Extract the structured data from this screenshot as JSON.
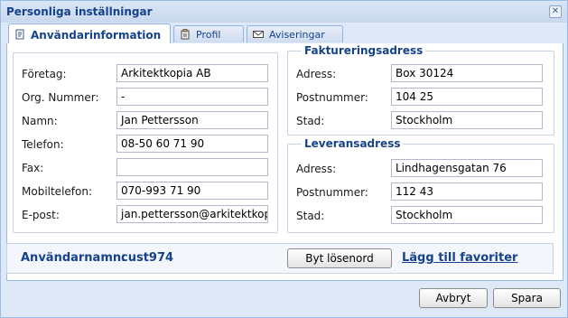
{
  "window": {
    "title": "Personliga inställningar"
  },
  "tabs": [
    {
      "label": "Användarinformation",
      "icon": "user-info-icon"
    },
    {
      "label": "Profil",
      "icon": "profile-icon"
    },
    {
      "label": "Aviseringar",
      "icon": "envelope-icon"
    }
  ],
  "personal": {
    "company_label": "Företag:",
    "company_value": "Arkitektkopia AB",
    "org_label": "Org. Nummer:",
    "org_value": "-",
    "name_label": "Namn:",
    "name_value": "Jan Pettersson",
    "phone_label": "Telefon:",
    "phone_value": "08-50 60 71 90",
    "fax_label": "Fax:",
    "fax_value": "",
    "mobile_label": "Mobiltelefon:",
    "mobile_value": "070-993 71 90",
    "email_label": "E-post:",
    "email_value": "jan.pettersson@arkitektkopia.se"
  },
  "billing": {
    "legend": "Faktureringsadress",
    "address_label": "Adress:",
    "address_value": "Box 30124",
    "zip_label": "Postnummer:",
    "zip_value": "104 25",
    "city_label": "Stad:",
    "city_value": "Stockholm"
  },
  "delivery": {
    "legend": "Leveransadress",
    "address_label": "Adress:",
    "address_value": "Lindhagensgatan 76",
    "zip_label": "Postnummer:",
    "zip_value": "112 43",
    "city_label": "Stad:",
    "city_value": "Stockholm"
  },
  "user": {
    "username_label": "Användarnamn:",
    "username_value": "cust974",
    "change_password_label": "Byt lösenord",
    "favorites_link": "Lägg till favoriter"
  },
  "footer": {
    "cancel_label": "Avbryt",
    "save_label": "Spara"
  },
  "colors": {
    "accent": "#15428b",
    "border": "#99bbe8",
    "window_bg": "#dfe8f6"
  }
}
